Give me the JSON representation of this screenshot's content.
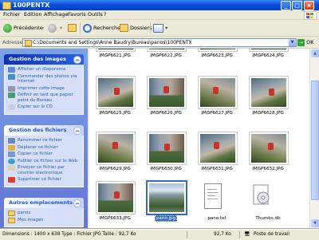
{
  "window": {
    "title": "100PENTX"
  },
  "menu": [
    "Fichier",
    "Edition",
    "Affichage",
    "Favoris",
    "Outils",
    "?"
  ],
  "toolbar": {
    "back": "Précédente",
    "search": "Rechercher",
    "folders": "Dossiers"
  },
  "address": {
    "label": "Adresse",
    "path": "C:\\Documents and Settings\\Anne Baudry\\Bureau\\panos\\100PENTX",
    "go": "OK"
  },
  "task_pane": {
    "image_tasks": {
      "title": "Gestion des images",
      "items": [
        "Afficher un diaporama",
        "Commander des photos via Internet",
        "Imprimer cette image",
        "Définir en tant que papier peint du Bureau",
        "Copier sur le CD"
      ]
    },
    "file_tasks": {
      "title": "Gestion des fichiers",
      "items": [
        "Renommer ce fichier",
        "Déplacer ce fichier",
        "Copier ce fichier",
        "Publier ce fichier sur le Web",
        "Envoyer ce fichier par courrier électronique",
        "Supprimer ce fichier"
      ]
    },
    "other_places": {
      "title": "Autres emplacements",
      "items": [
        "panos",
        "Mes images"
      ]
    }
  },
  "files": {
    "row0": [
      "IMGP6621.JPG",
      "IMGP6622.JPG",
      "IMGP6623.JPG",
      "IMGP6624.JPG"
    ],
    "row1": [
      "IMGP6625.JPG",
      "IMGP6626.JPG",
      "IMGP6627.JPG",
      "IMGP6628.JPG"
    ],
    "row2": [
      "IMGP6629.JPG",
      "IMGP6630.JPG",
      "IMGP6631.JPG",
      "IMGP6632.JPG"
    ],
    "row3": [
      "IMGP6633.JPG",
      "pano.jpg",
      "pano.txt",
      "Thumbs.db"
    ],
    "selected": "pano.jpg"
  },
  "status": {
    "info": "Dimensions : 1400 x 638 Type : Fichier JPG Taille : 92,7 Ko",
    "size": "92,7 Ko",
    "location": "Poste de travail"
  },
  "colors": {
    "titlebar": "#0A4FD8",
    "selection": "#316AC5",
    "taskpane": "#6F8FDF"
  }
}
